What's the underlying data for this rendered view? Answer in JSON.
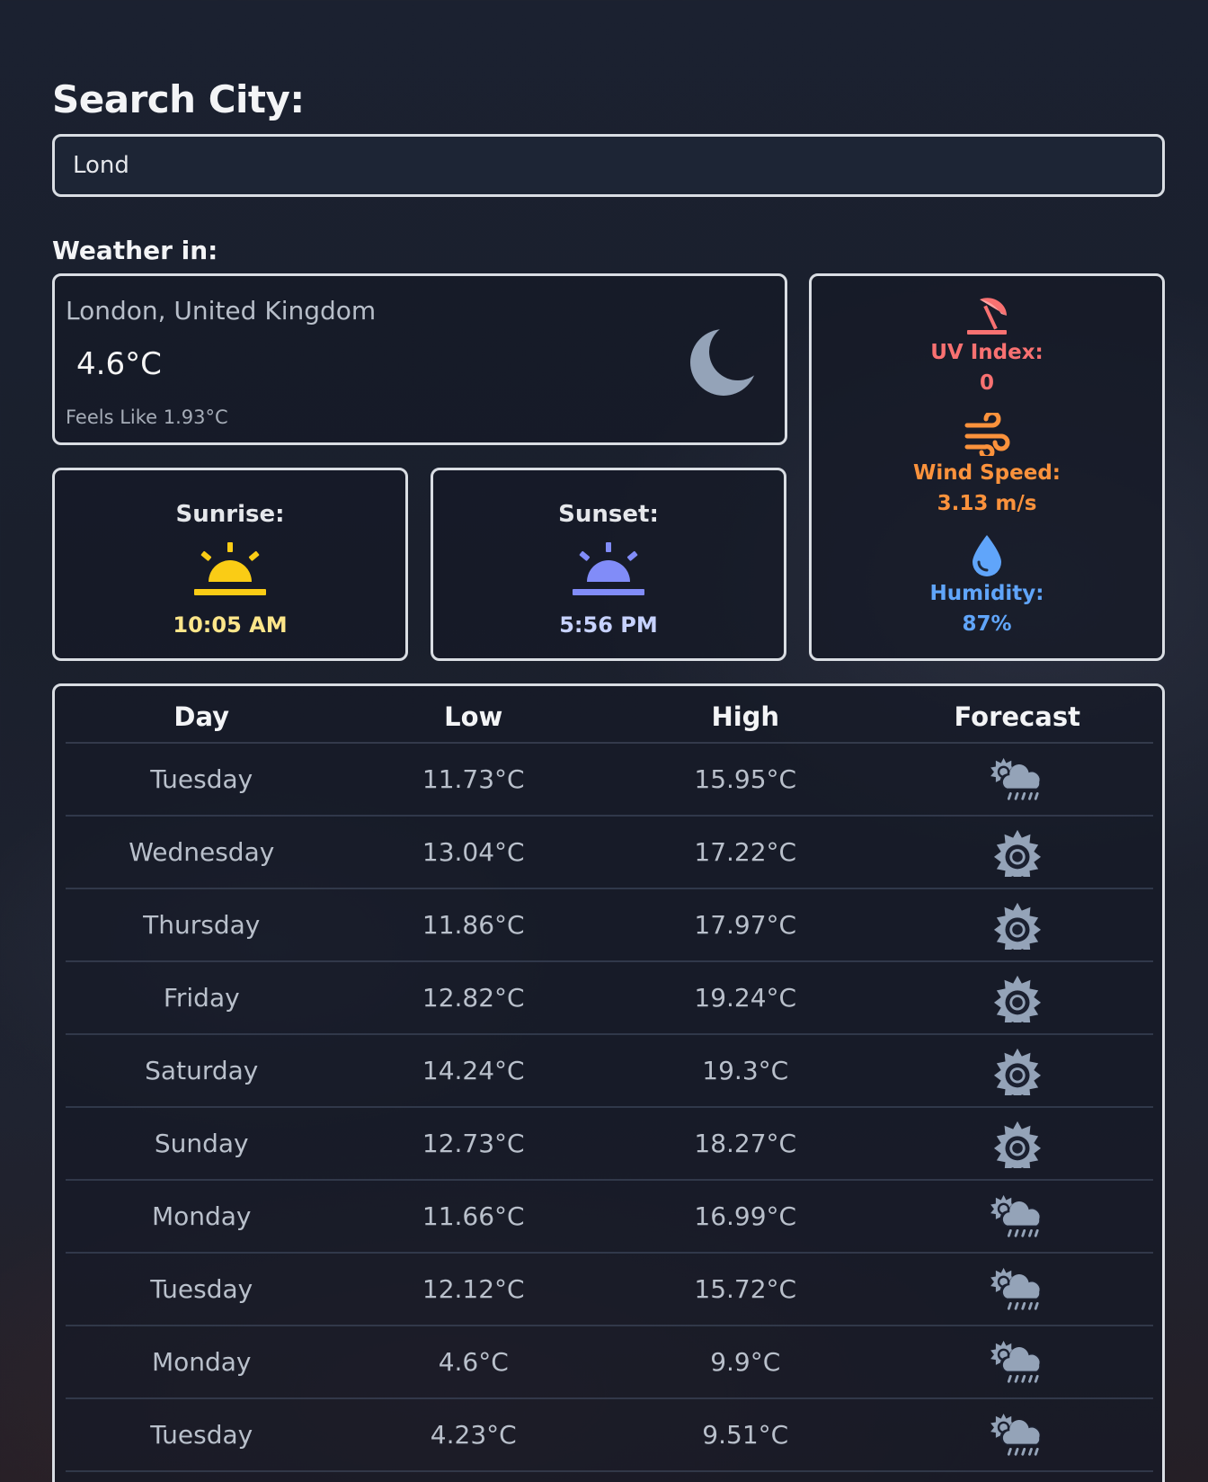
{
  "search": {
    "title": "Search City:",
    "value": "Lond",
    "placeholder": ""
  },
  "weather": {
    "heading": "Weather in:",
    "location": "London, United Kingdom",
    "temperature": "4.6°C",
    "feels_like": "Feels Like 1.93°C",
    "icon": "moon-icon"
  },
  "sunrise": {
    "label": "Sunrise:",
    "time": "10:05 AM",
    "icon": "sunrise-icon",
    "color": "#facc15"
  },
  "sunset": {
    "label": "Sunset:",
    "time": "5:56 PM",
    "icon": "sunset-icon",
    "color": "#818cf8"
  },
  "stats": {
    "uv": {
      "label": "UV Index:",
      "value": "0",
      "icon": "umbrella-beach-icon",
      "color": "#f87171"
    },
    "wind": {
      "label": "Wind Speed:",
      "value": "3.13 m/s",
      "icon": "wind-icon",
      "color": "#fb923c"
    },
    "humidity": {
      "label": "Humidity:",
      "value": "87%",
      "icon": "droplet-icon",
      "color": "#60a5fa"
    }
  },
  "forecast": {
    "headers": {
      "day": "Day",
      "low": "Low",
      "high": "High",
      "forecast": "Forecast"
    },
    "rows": [
      {
        "day": "Tuesday",
        "low": "11.73°C",
        "high": "15.95°C",
        "icon": "sun-rain-cloud-icon"
      },
      {
        "day": "Wednesday",
        "low": "13.04°C",
        "high": "17.22°C",
        "icon": "sun-icon"
      },
      {
        "day": "Thursday",
        "low": "11.86°C",
        "high": "17.97°C",
        "icon": "sun-icon"
      },
      {
        "day": "Friday",
        "low": "12.82°C",
        "high": "19.24°C",
        "icon": "sun-icon"
      },
      {
        "day": "Saturday",
        "low": "14.24°C",
        "high": "19.3°C",
        "icon": "sun-icon"
      },
      {
        "day": "Sunday",
        "low": "12.73°C",
        "high": "18.27°C",
        "icon": "sun-icon"
      },
      {
        "day": "Monday",
        "low": "11.66°C",
        "high": "16.99°C",
        "icon": "sun-rain-cloud-icon"
      },
      {
        "day": "Tuesday",
        "low": "12.12°C",
        "high": "15.72°C",
        "icon": "sun-rain-cloud-icon"
      },
      {
        "day": "Monday",
        "low": "4.6°C",
        "high": "9.9°C",
        "icon": "sun-rain-cloud-icon"
      },
      {
        "day": "Tuesday",
        "low": "4.23°C",
        "high": "9.51°C",
        "icon": "sun-rain-cloud-icon"
      }
    ]
  }
}
